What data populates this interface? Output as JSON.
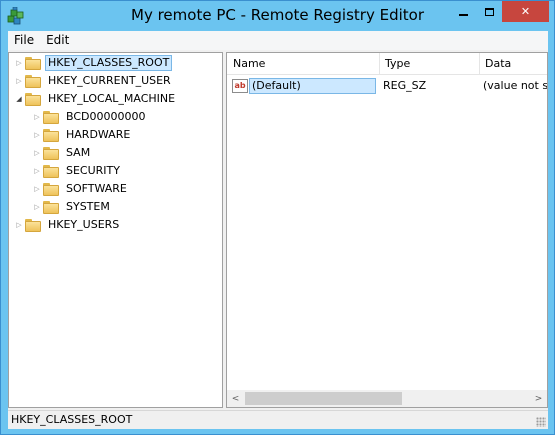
{
  "window": {
    "title": "My remote PC - Remote Registry Editor",
    "accent": "#6bc4f0",
    "close_color": "#c7463e",
    "icons": {
      "app": "registry-cubes-icon",
      "minimize": "minimize-icon",
      "maximize": "maximize-icon",
      "close": "close-icon"
    },
    "close_glyph": "✕"
  },
  "menu": {
    "items": [
      {
        "label": "File"
      },
      {
        "label": "Edit"
      }
    ]
  },
  "tree": {
    "items": [
      {
        "label": "HKEY_CLASSES_ROOT",
        "level": 0,
        "expanded": false,
        "selected": true
      },
      {
        "label": "HKEY_CURRENT_USER",
        "level": 0,
        "expanded": false,
        "selected": false
      },
      {
        "label": "HKEY_LOCAL_MACHINE",
        "level": 0,
        "expanded": true,
        "selected": false
      },
      {
        "label": "BCD00000000",
        "level": 1,
        "expanded": false,
        "selected": false
      },
      {
        "label": "HARDWARE",
        "level": 1,
        "expanded": false,
        "selected": false
      },
      {
        "label": "SAM",
        "level": 1,
        "expanded": false,
        "selected": false
      },
      {
        "label": "SECURITY",
        "level": 1,
        "expanded": false,
        "selected": false
      },
      {
        "label": "SOFTWARE",
        "level": 1,
        "expanded": false,
        "selected": false
      },
      {
        "label": "SYSTEM",
        "level": 1,
        "expanded": false,
        "selected": false
      },
      {
        "label": "HKEY_USERS",
        "level": 0,
        "expanded": false,
        "selected": false
      }
    ],
    "collapsed_glyph": "▷",
    "expanded_glyph": "◢"
  },
  "list": {
    "columns": [
      {
        "label": "Name"
      },
      {
        "label": "Type"
      },
      {
        "label": "Data"
      }
    ],
    "rows": [
      {
        "icon": "string-value-icon",
        "icon_text": "ab",
        "name": "(Default)",
        "type": "REG_SZ",
        "data": "(value not set)"
      }
    ],
    "scroll_left_glyph": "<",
    "scroll_right_glyph": ">"
  },
  "status": {
    "path": "HKEY_CLASSES_ROOT"
  }
}
